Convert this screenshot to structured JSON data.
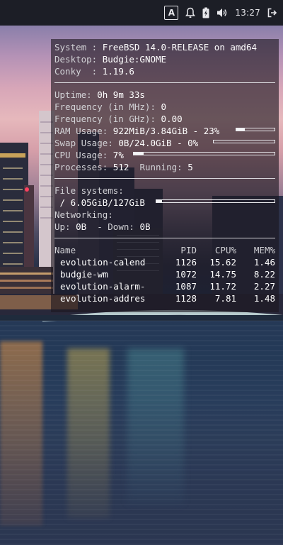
{
  "panel": {
    "keyboard_layout": "A",
    "clock": "13:27",
    "icons": [
      "keyboard-layout-icon",
      "notification-bell-icon",
      "battery-icon",
      "volume-icon",
      "logout-icon"
    ]
  },
  "conky": {
    "system": {
      "system_label": "System :",
      "system_value": "FreeBSD 14.0-RELEASE on amd64",
      "desktop_label": "Desktop:",
      "desktop_value": "Budgie:GNOME",
      "conky_label": "Conky  :",
      "conky_value": "1.19.6"
    },
    "stats": {
      "uptime_label": "Uptime:",
      "uptime_value": "0h 9m 33s",
      "freq_mhz_label": "Frequency (in MHz):",
      "freq_mhz_value": "0",
      "freq_ghz_label": "Frequency (in GHz):",
      "freq_ghz_value": "0.00",
      "ram_label": "RAM Usage:",
      "ram_value": "922MiB/3.84GiB - 23%",
      "ram_percent": 23,
      "swap_label": "Swap Usage:",
      "swap_value": "0B/24.0GiB - 0%",
      "swap_percent": 0,
      "cpu_label": "CPU Usage:",
      "cpu_value": "7%",
      "cpu_percent": 7,
      "processes_label": "Processes:",
      "processes_value": "512",
      "running_label": "Running:",
      "running_value": "5"
    },
    "filesystems": {
      "label": "File systems:",
      "root_value": "/ 6.05GiB/127GiB",
      "root_percent": 5,
      "networking_label": "Networking:",
      "up_label": "Up:",
      "up_value": "0B",
      "down_label": "- Down:",
      "down_value": "0B"
    },
    "processes_table": {
      "headers": {
        "name": "Name",
        "pid": "PID",
        "cpu": "CPU%",
        "mem": "MEM%"
      },
      "rows": [
        {
          "name": "evolution-calend",
          "pid": "1126",
          "cpu": "15.62",
          "mem": "1.46"
        },
        {
          "name": "budgie-wm",
          "pid": "1072",
          "cpu": "14.75",
          "mem": "8.22"
        },
        {
          "name": "evolution-alarm-",
          "pid": "1087",
          "cpu": "11.72",
          "mem": "2.27"
        },
        {
          "name": "evolution-addres",
          "pid": "1128",
          "cpu": "7.81",
          "mem": "1.48"
        }
      ]
    }
  }
}
